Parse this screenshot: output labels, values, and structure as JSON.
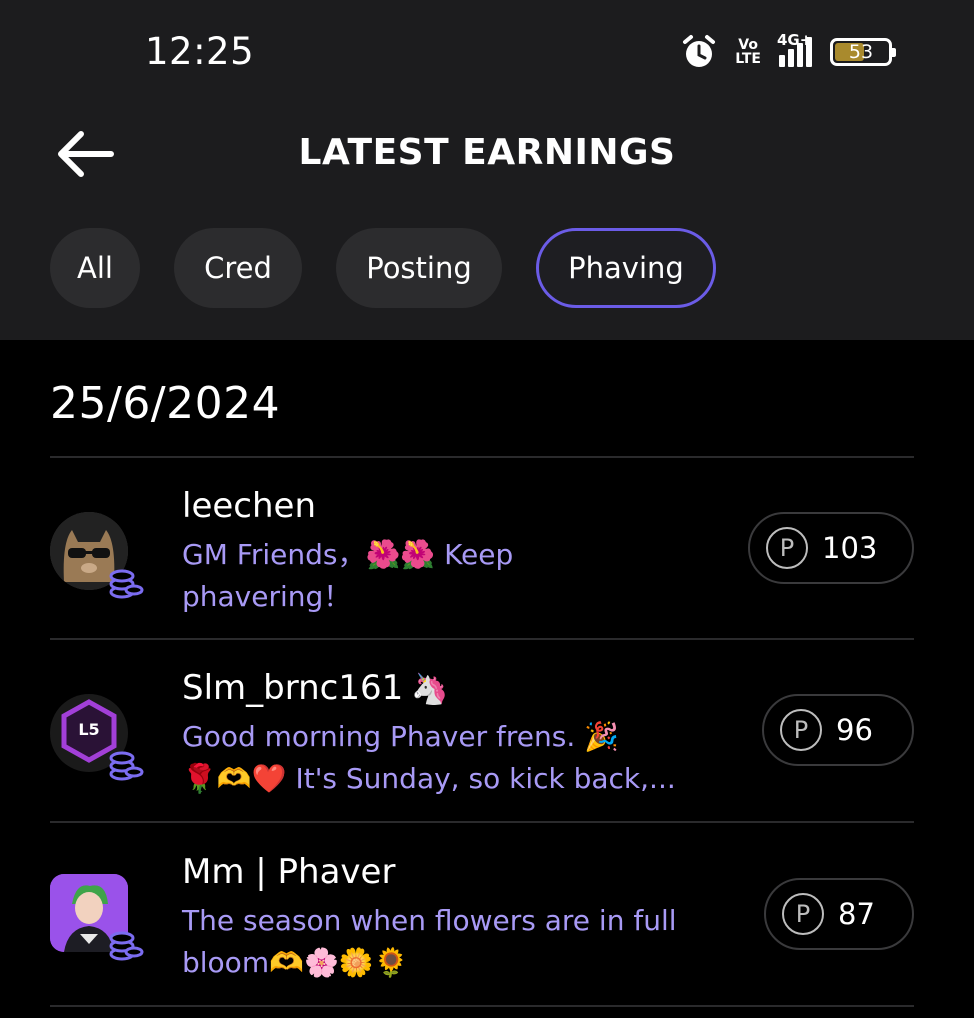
{
  "status": {
    "time": "12:25",
    "volte_top": "Vo",
    "volte_bottom": "LTE",
    "network": "4G+",
    "battery": "53"
  },
  "header": {
    "title": "LATEST EARNINGS"
  },
  "tabs": [
    {
      "label": "All"
    },
    {
      "label": "Cred"
    },
    {
      "label": "Posting"
    },
    {
      "label": "Phaving",
      "active": true
    }
  ],
  "date": "25/6/2024",
  "earnings": [
    {
      "username": "leechen",
      "message_line1": "GM Friends，🌺🌺 Keep",
      "message_line2": "phavering！",
      "points": "103"
    },
    {
      "username": "Slm_brnc161",
      "username_emoji": "🦄",
      "level_badge": "L5",
      "message_line1": "Good morning Phaver frens. 🎉",
      "message_line2": "🌹🫶❤️ It's Sunday, so kick back,...",
      "points": "96"
    },
    {
      "username": "Mm | Phaver",
      "message_line1": "The season when flowers are in full",
      "message_line2": "bloom🫶🌸🌼🌻",
      "points": "87"
    }
  ],
  "points_icon_letter": "P",
  "colors": {
    "header_bg": "#1c1c1e",
    "accent": "#6b5ce7",
    "message_text": "#a89af5",
    "coin": "#7b6cf0"
  }
}
